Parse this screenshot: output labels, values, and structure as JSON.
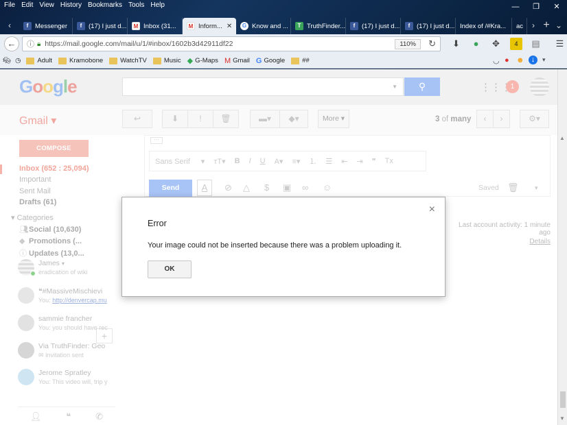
{
  "menu": [
    "File",
    "Edit",
    "View",
    "History",
    "Bookmarks",
    "Tools",
    "Help"
  ],
  "window_controls": {
    "minimize": "—",
    "restore": "❐",
    "close": "✕"
  },
  "tabs": [
    {
      "label": "Messenger",
      "fav": "f"
    },
    {
      "label": "(17) I just d...",
      "fav": "f"
    },
    {
      "label": "Inbox (31...",
      "fav": "M"
    },
    {
      "label": "Inform...",
      "fav": "M",
      "active": true
    },
    {
      "label": "Know and ...",
      "fav": "G"
    },
    {
      "label": "TruthFinder...",
      "fav": "T"
    },
    {
      "label": "(17) I just d...",
      "fav": "f"
    },
    {
      "label": "(17) I just d...",
      "fav": "f"
    },
    {
      "label": "Index of /#Kra...",
      "fav": ""
    },
    {
      "label": "ac",
      "fav": ""
    }
  ],
  "tab_nav": {
    "left": "‹",
    "right": "›",
    "new": "+",
    "list": "⌄"
  },
  "url": "https://mail.google.com/mail/u/1/#inbox/1602b3d42911df22",
  "zoom": "110%",
  "nav_icons": [
    "⬇",
    "●",
    "✥",
    "4",
    "▤",
    "☰"
  ],
  "bookmarks": [
    {
      "label": "Adult",
      "type": "folder"
    },
    {
      "label": "Kramobone",
      "type": "folder"
    },
    {
      "label": "WatchTV",
      "type": "folder"
    },
    {
      "label": "Music",
      "type": "folder"
    },
    {
      "label": "G-Maps",
      "type": "maps"
    },
    {
      "label": "Gmail",
      "type": "gmail"
    },
    {
      "label": "Google",
      "type": "google"
    },
    {
      "label": "##",
      "type": "folder"
    }
  ],
  "logo": {
    "G": "G",
    "o1": "o",
    "o2": "o",
    "g": "g",
    "l": "l",
    "e": "e"
  },
  "gmail_label": "Gmail ▾",
  "toolbar": {
    "more": "More ▾",
    "pager_range": "3",
    "pager_of": "of",
    "pager_total": "many"
  },
  "notification_count": "1",
  "sidebar": {
    "compose": "COMPOSE",
    "inbox": "Inbox (652 : 25,094)",
    "important": "Important",
    "sent": "Sent Mail",
    "drafts": "Drafts (61)",
    "categories": "Categories",
    "social": "Social (10,630)",
    "promotions": "Promotions (...",
    "updates": "Updates (13,0..."
  },
  "chats": [
    {
      "name": "James",
      "sub": "eradication of wiki"
    },
    {
      "name": "#MassiveMischievi",
      "sub_prefix": "You: ",
      "sub_link": "http://denvercap.mu"
    },
    {
      "name": "sammie francher",
      "sub": "You: you should have rec"
    },
    {
      "name": "Via TruthFinder: Geo",
      "sub": "Invitation sent"
    },
    {
      "name": "Jerome Spratley",
      "sub": "You: This video will, trip y"
    }
  ],
  "compose_area": {
    "send": "Send",
    "saved": "Saved",
    "font": "Sans Serif"
  },
  "activity": {
    "last": "Last account activity: 1 minute ago",
    "details": "Details"
  },
  "dialog": {
    "title": "Error",
    "message": "Your image could not be inserted because there was a problem uploading it.",
    "ok": "OK",
    "close": "×"
  }
}
